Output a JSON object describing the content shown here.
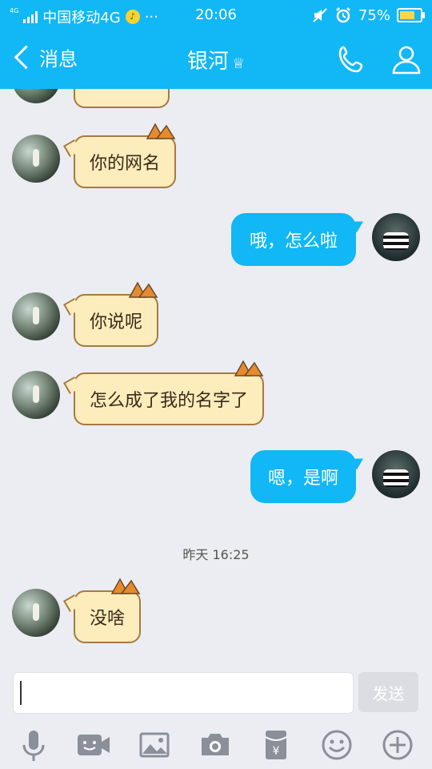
{
  "status_bar": {
    "carrier": "中国移动4G",
    "network_badge": "4G",
    "more": "···",
    "time": "20:06",
    "battery": "75%",
    "battery_level": 0.75
  },
  "header": {
    "back_label": "消息",
    "contact_name": "银河",
    "crown_icon": "crown-icon",
    "call_icon": "phone-icon",
    "profile_icon": "person-icon"
  },
  "messages": [
    {
      "side": "left",
      "text": "你的网名"
    },
    {
      "side": "right",
      "text": "哦，怎么啦"
    },
    {
      "side": "left",
      "text": "你说呢"
    },
    {
      "side": "left",
      "text": "怎么成了我的名字了"
    },
    {
      "side": "right",
      "text": "嗯，是啊"
    },
    {
      "side": "left",
      "text": "没啥"
    }
  ],
  "timestamp": "昨天 16:25",
  "composer": {
    "send_label": "发送",
    "input_value": ""
  },
  "toolbar_icons": [
    "microphone-icon",
    "video-call-icon",
    "image-icon",
    "camera-icon",
    "red-packet-icon",
    "emoji-icon",
    "plus-icon"
  ],
  "colors": {
    "accent": "#12b7f5",
    "cat_bubble": "#fdecbc",
    "background": "#ebedf2"
  }
}
